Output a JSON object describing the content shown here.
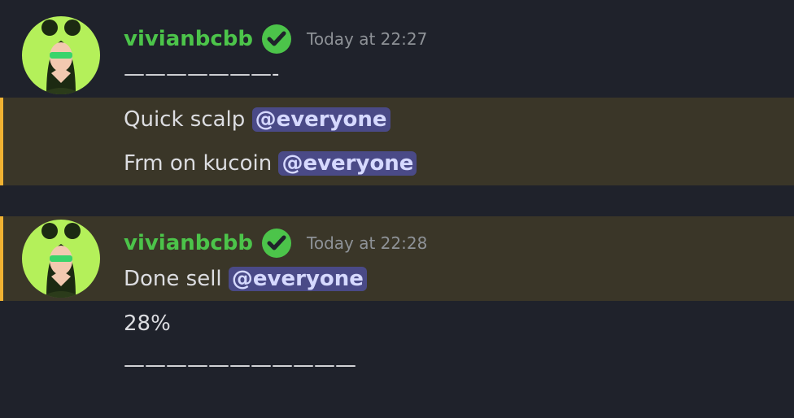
{
  "colors": {
    "background": "#1f222b",
    "highlight_bg": "#3a3628",
    "highlight_bar": "#f0b232",
    "username": "#4cc44a",
    "mention_bg": "#4a4a87",
    "timestamp": "#8e9297"
  },
  "messages": [
    {
      "username": "vivianbcbb",
      "timestamp": "Today at 22:27",
      "avatar_icon": "user-avatar-icon",
      "badge_icon": "verified-check-icon",
      "lines": [
        {
          "text": "———————-",
          "mention": ""
        },
        {
          "text": "Quick scalp ",
          "mention": "@everyone"
        },
        {
          "text": "Frm on kucoin ",
          "mention": "@everyone"
        }
      ]
    },
    {
      "username": "vivianbcbb",
      "timestamp": "Today at 22:28",
      "avatar_icon": "user-avatar-icon",
      "badge_icon": "verified-check-icon",
      "lines": [
        {
          "text": "Done sell ",
          "mention": "@everyone"
        },
        {
          "text": "28%",
          "mention": ""
        },
        {
          "text": "———————————",
          "mention": ""
        }
      ]
    }
  ]
}
